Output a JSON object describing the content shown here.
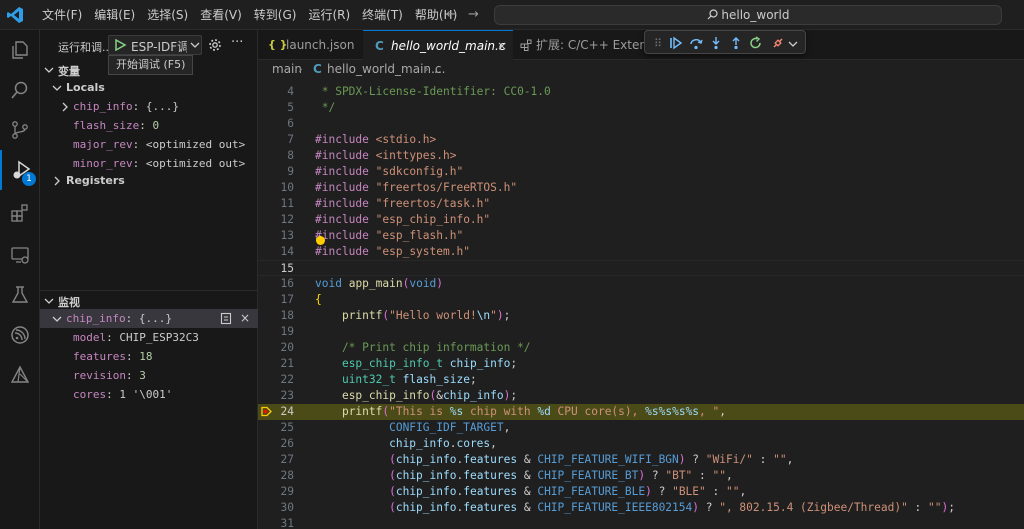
{
  "titlebar": {
    "menus": [
      "文件(F)",
      "编辑(E)",
      "选择(S)",
      "查看(V)",
      "转到(G)",
      "运行(R)",
      "终端(T)",
      "帮助(H)"
    ],
    "search_text": "hello_world"
  },
  "sidebar": {
    "run_title": "运行和调...",
    "config_name": "ESP-IDF调试",
    "tooltip": "开始调试 (F5)",
    "variables_header": "变量",
    "locals_label": "Locals",
    "registers_label": "Registers",
    "locals": [
      {
        "name": "chip_info",
        "value": "{...}",
        "expandable": true
      },
      {
        "name": "flash_size",
        "value": "0"
      },
      {
        "name": "major_rev",
        "value": "<optimized out>"
      },
      {
        "name": "minor_rev",
        "value": "<optimized out>"
      }
    ],
    "watch_header": "监视",
    "watch_root": {
      "name": "chip_info",
      "value": "{...}"
    },
    "watch_children": [
      {
        "name": "model",
        "value": "CHIP_ESP32C3"
      },
      {
        "name": "features",
        "value": "18"
      },
      {
        "name": "revision",
        "value": "3"
      },
      {
        "name": "cores",
        "value": "1 '\\001'"
      }
    ],
    "debug_badge": "1"
  },
  "tabs": [
    {
      "label": "launch.json",
      "icon": "{ }"
    },
    {
      "label": "hello_world_main.c",
      "icon": "C",
      "active": true
    },
    {
      "label": "扩展: C/C++ Extension",
      "icon": "extensions-icon"
    }
  ],
  "breadcrumb": {
    "folder": "main",
    "file": "hello_world_main.c",
    "more": "..."
  },
  "code": {
    "lines": [
      {
        "n": "4",
        "t": " * SPDX-License-Identifier: CC0-1.0"
      },
      {
        "n": "5",
        "t": " */"
      },
      {
        "n": "6",
        "t": ""
      },
      {
        "n": "7",
        "t": "#include <stdio.h>"
      },
      {
        "n": "8",
        "t": "#include <inttypes.h>"
      },
      {
        "n": "9",
        "t": "#include \"sdkconfig.h\""
      },
      {
        "n": "10",
        "t": "#include \"freertos/FreeRTOS.h\""
      },
      {
        "n": "11",
        "t": "#include \"freertos/task.h\""
      },
      {
        "n": "12",
        "t": "#include \"esp_chip_info.h\""
      },
      {
        "n": "13",
        "t": "#include \"esp_flash.h\""
      },
      {
        "n": "14",
        "t": "#include \"esp_system.h\""
      },
      {
        "n": "15",
        "t": ""
      },
      {
        "n": "16",
        "t": "void app_main(void)"
      },
      {
        "n": "17",
        "t": "{"
      },
      {
        "n": "18",
        "t": "    printf(\"Hello world!\\n\");"
      },
      {
        "n": "19",
        "t": ""
      },
      {
        "n": "20",
        "t": "    /* Print chip information */"
      },
      {
        "n": "21",
        "t": "    esp_chip_info_t chip_info;"
      },
      {
        "n": "22",
        "t": "    uint32_t flash_size;"
      },
      {
        "n": "23",
        "t": "    esp_chip_info(&chip_info);"
      },
      {
        "n": "24",
        "t": "    printf(\"This is %s chip with %d CPU core(s), %s%s%s%s, \","
      },
      {
        "n": "25",
        "t": "           CONFIG_IDF_TARGET,"
      },
      {
        "n": "26",
        "t": "           chip_info.cores,"
      },
      {
        "n": "27",
        "t": "           (chip_info.features & CHIP_FEATURE_WIFI_BGN) ? \"WiFi/\" : \"\","
      },
      {
        "n": "28",
        "t": "           (chip_info.features & CHIP_FEATURE_BT) ? \"BT\" : \"\","
      },
      {
        "n": "29",
        "t": "           (chip_info.features & CHIP_FEATURE_BLE) ? \"BLE\" : \"\","
      },
      {
        "n": "30",
        "t": "           (chip_info.features & CHIP_FEATURE_IEEE802154) ? \", 802.15.4 (Zigbee/Thread)\" : \"\");"
      },
      {
        "n": "31",
        "t": ""
      }
    ],
    "current_line": "24",
    "cursor_line": "15"
  },
  "colors": {
    "accent": "#0078d4",
    "debug_green": "#89d185",
    "highlight": "#4b4b18"
  }
}
